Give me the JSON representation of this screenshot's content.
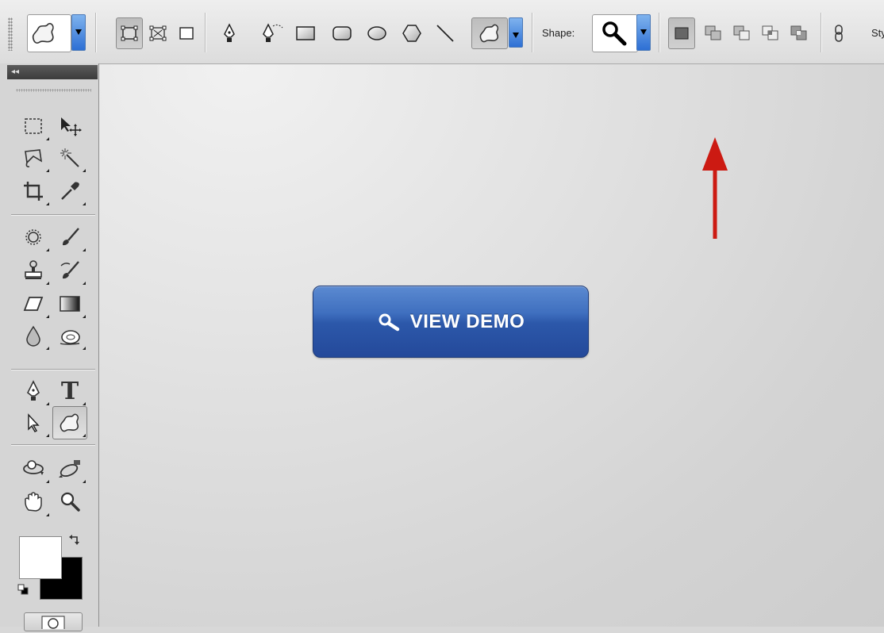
{
  "options_bar": {
    "tool_preset_icon": "custom-shape-icon",
    "path_modes": [
      "shape-layers-icon",
      "paths-icon",
      "fill-pixels-icon"
    ],
    "shape_tools": [
      "pen-icon",
      "freeform-pen-icon",
      "rectangle-icon",
      "rounded-rectangle-icon",
      "ellipse-icon",
      "polygon-icon",
      "line-icon",
      "custom-shape-icon"
    ],
    "shape_label": "Shape:",
    "shape_picker_icon": "magnifier-icon",
    "combine_modes": [
      "new-shape-icon",
      "add-icon",
      "subtract-icon",
      "intersect-icon",
      "exclude-icon"
    ],
    "link_icon": "link-icon",
    "style_label": "Sty"
  },
  "tools_panel": {
    "collapse_label": "◂◂",
    "tools": [
      "marquee-icon",
      "move-icon",
      "lasso-icon",
      "magic-wand-icon",
      "crop-icon",
      "eyedropper-icon",
      "healing-icon",
      "brush-icon",
      "clone-stamp-icon",
      "history-brush-icon",
      "eraser-icon",
      "gradient-icon",
      "blur-icon",
      "dodge-icon",
      "pen-icon",
      "type-icon",
      "path-selection-icon",
      "custom-shape-icon",
      "3d-rotate-icon",
      "3d-orbit-icon",
      "hand-icon",
      "zoom-icon"
    ],
    "type_tool_label": "T",
    "foreground_color": "#ffffff",
    "background_color": "#000000"
  },
  "canvas": {
    "button_label": "VIEW DEMO",
    "button_icon": "magnifier-icon",
    "button_color": "#2c58aa",
    "annotation_arrow_color": "#cc1a12"
  }
}
